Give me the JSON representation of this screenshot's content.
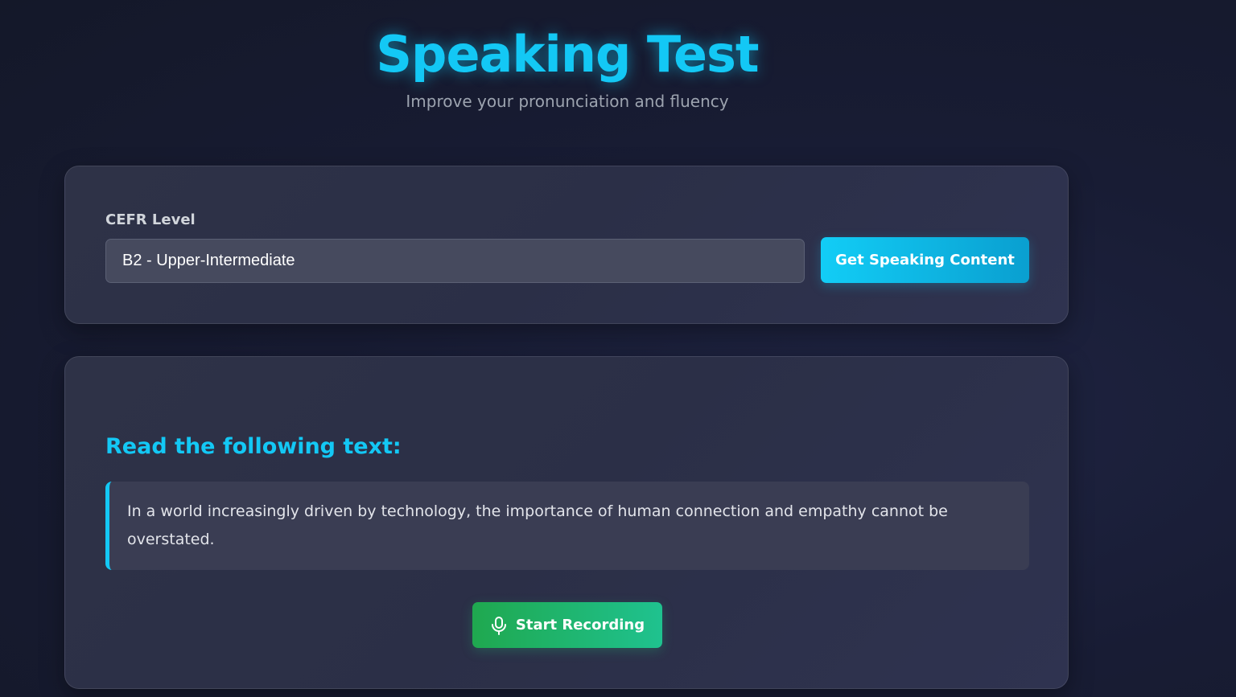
{
  "header": {
    "title": "Speaking Test",
    "subtitle": "Improve your pronunciation and fluency"
  },
  "level_card": {
    "label": "CEFR Level",
    "selected_level": "B2 - Upper-Intermediate",
    "get_content_label": "Get Speaking Content"
  },
  "reading_card": {
    "heading": "Read the following text:",
    "text": "In a world increasingly driven by technology, the importance of human connection and empathy cannot be overstated.",
    "record_label": "Start Recording",
    "record_icon": "microphone-icon"
  },
  "colors": {
    "accent": "#13c8f5",
    "record_button": "#1fa84f",
    "background": "#181c34",
    "card": "#2e3247"
  }
}
